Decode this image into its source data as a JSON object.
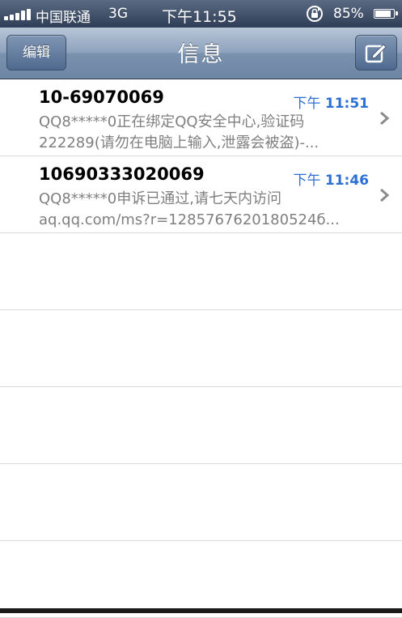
{
  "status_bar": {
    "carrier": "中国联通",
    "network": "3G",
    "time": "下午11:55",
    "battery": "85%",
    "battery_level": 0.85,
    "signal_bars": 5
  },
  "nav": {
    "edit_label": "编辑",
    "title": "信息",
    "compose_icon": "compose-icon"
  },
  "messages": [
    {
      "sender": "10-69070069",
      "time_prefix": "下午",
      "time": "11:51",
      "preview_line1": "QQ8*****0正在绑定QQ安全中心,验证码",
      "preview_line2": "222289(请勿在电脑上输入,泄露会被盗)-..."
    },
    {
      "sender": "10690333020069",
      "time_prefix": "下午",
      "time": "11:46",
      "preview_line1": "QQ8*****0申诉已通过,请七天内访问",
      "preview_line2": "aq.qq.com/ms?r=1285767620180524б..."
    }
  ],
  "colors": {
    "time_blue": "#2b6fd3",
    "preview_gray": "#7f7f7f"
  }
}
